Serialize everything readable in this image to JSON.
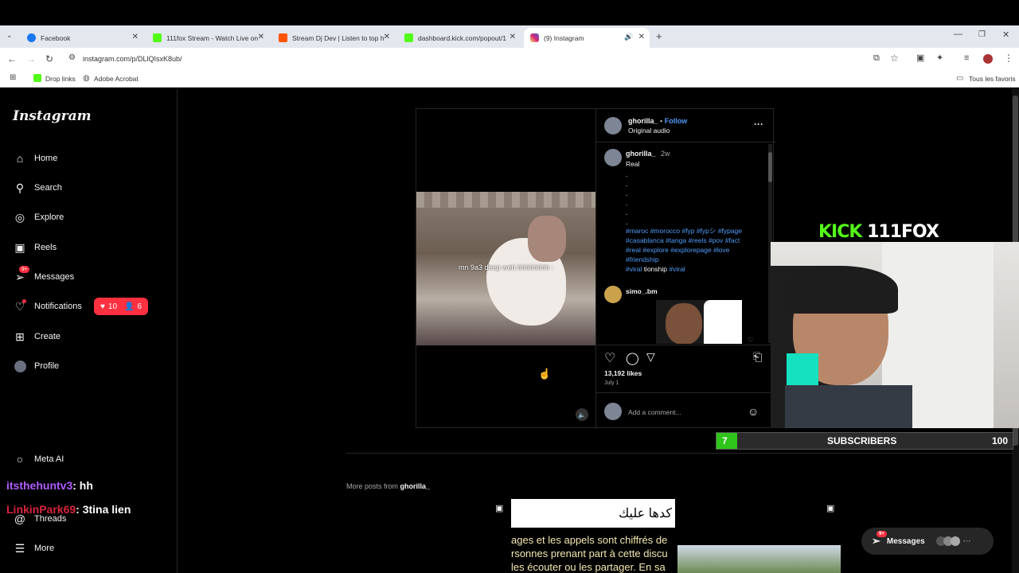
{
  "browser": {
    "tabs": [
      {
        "title": "Facebook",
        "favicon_color": "#1877f2"
      },
      {
        "title": "111fox Stream - Watch Live on",
        "favicon_color": "#53fc18"
      },
      {
        "title": "Stream Dj Dev | Listen to top h",
        "favicon_color": "#ff5500"
      },
      {
        "title": "dashboard.kick.com/popout/1",
        "favicon_color": "#53fc18"
      },
      {
        "title": "(9) Instagram",
        "favicon_color": "#d6249f"
      }
    ],
    "new_tab": "+",
    "url": "instagram.com/p/DLlQIsxK8ub/",
    "bookmarks": [
      {
        "label": "Drop links",
        "icon": "kick-icon"
      },
      {
        "label": "Adobe Acrobat",
        "icon": "globe-icon"
      }
    ],
    "all_bookmarks": "Tous les favoris"
  },
  "instagram": {
    "logo": "Instagram",
    "nav": [
      {
        "label": "Home",
        "icon": "home-icon"
      },
      {
        "label": "Search",
        "icon": "search-icon"
      },
      {
        "label": "Explore",
        "icon": "explore-icon"
      },
      {
        "label": "Reels",
        "icon": "reels-icon"
      },
      {
        "label": "Messages",
        "icon": "messages-icon",
        "badge": "9+"
      },
      {
        "label": "Notifications",
        "icon": "heart-icon"
      },
      {
        "label": "Create",
        "icon": "create-icon"
      },
      {
        "label": "Profile",
        "icon": "avatar"
      }
    ],
    "notif_popup": {
      "likes": "10",
      "follows": "6"
    },
    "bottom_nav": [
      {
        "label": "Meta AI"
      },
      {
        "label": "Threads"
      },
      {
        "label": "More"
      }
    ]
  },
  "post": {
    "video_caption": "mn 9a3 deep web hhhhhhhh :",
    "username": "ghorilla_",
    "follow": "Follow",
    "dot": "•",
    "audio": "Original audio",
    "more": "···",
    "caption_user": "ghorilla_",
    "caption_time": "2w",
    "caption_text": "Real",
    "dots": [
      ".",
      ".",
      ".",
      ".",
      ".",
      "."
    ],
    "hashtags": [
      "#maroc #morocco #fyp #fypシ #fypage",
      "#casablanca #tanga #reels #pov #fact",
      "#real #explore #explorepage #love",
      "#friendship"
    ],
    "last_line": {
      "tag1": "#viral",
      "word": "tionship",
      "tag2": "#viral"
    },
    "comment_user": "simo_.bm",
    "likes": "13,192 likes",
    "date": "July 1",
    "add_comment": "Add a comment...",
    "more_posts_prefix": "More posts from",
    "more_posts_user": "ghorilla_",
    "thumb_arabic": "كدها عليك",
    "thumb_french": [
      "ages et les appels sont chiffrés de",
      "rsonnes prenant part à cette discu",
      "les écouter ou les partager. En sa"
    ]
  },
  "stream_overlay": {
    "kick_logo": "KICK",
    "channel": "111FOX",
    "sub_count": "7",
    "sub_label": "SUBSCRIBERS",
    "sub_goal": "100",
    "sub_progress": 0.07
  },
  "chat": [
    {
      "user": "itsthehuntv3",
      "message": ": hh",
      "color": "#b05cff"
    },
    {
      "user": "LinkinPark69",
      "message": ": 3tina lien",
      "color": "#d8243a"
    }
  ],
  "messages_pill": {
    "label": "Messages",
    "badge": "9+"
  }
}
